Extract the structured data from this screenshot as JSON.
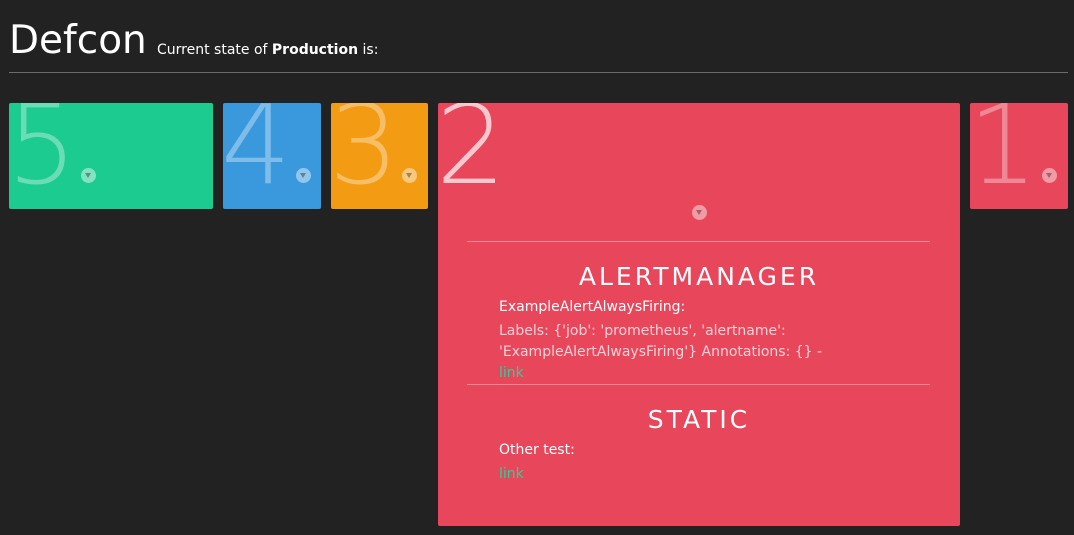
{
  "header": {
    "title": "Defcon",
    "subtitle_prefix": "Current state of ",
    "environment": "Production",
    "subtitle_suffix": " is:"
  },
  "levels": [
    {
      "number": "5",
      "color": "#1ccb8f"
    },
    {
      "number": "4",
      "color": "#3a99dd"
    },
    {
      "number": "3",
      "color": "#f39c13"
    },
    {
      "number": "2",
      "color": "#e8475b",
      "active": true
    },
    {
      "number": "1",
      "color": "#e8475b"
    }
  ],
  "active_panel": {
    "sections": [
      {
        "title": "ALERTMANAGER",
        "alert_name": "ExampleAlertAlwaysFiring:",
        "detail": "Labels: {'job': 'prometheus', 'alertname': 'ExampleAlertAlwaysFiring'} Annotations: {} - ",
        "link_label": "link"
      },
      {
        "title": "STATIC",
        "alert_name": "Other test:",
        "link_label": "link"
      }
    ]
  },
  "icons": {
    "expand": "chevron-down-icon"
  },
  "colors": {
    "background": "#222222",
    "link": "#2bd19a"
  }
}
